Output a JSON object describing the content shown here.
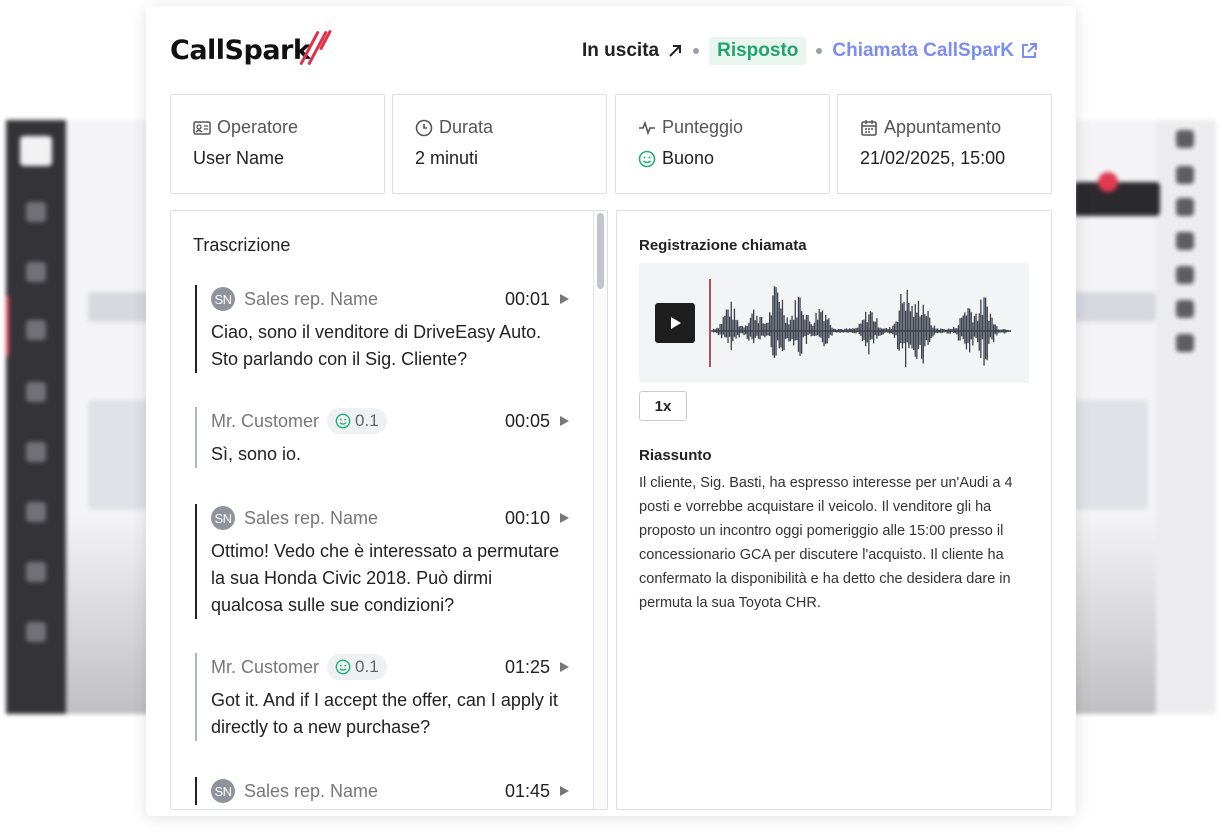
{
  "brand": {
    "name": "CallSpark",
    "accent": "#e0304a"
  },
  "header": {
    "direction": "In uscita",
    "status": "Risposto",
    "link_label": "Chiamata CallSparK"
  },
  "stats": [
    {
      "label": "Operatore",
      "value": "User Name",
      "icon": "id-card-icon"
    },
    {
      "label": "Durata",
      "value": "2 minuti",
      "icon": "clock-icon"
    },
    {
      "label": "Punteggio",
      "value": "Buono",
      "icon": "activity-icon"
    },
    {
      "label": "Appuntamento",
      "value": "21/02/2025, 15:00",
      "icon": "calendar-icon"
    }
  ],
  "transcript": {
    "title": "Trascrizione",
    "messages": [
      {
        "avatar": "SN",
        "speaker": "Sales rep. Name",
        "time": "00:01",
        "text": "Ciao, sono il venditore di DriveEasy Auto. Sto parlando con il Sig. Cliente?"
      },
      {
        "speaker": "Mr. Customer",
        "score": "0.1",
        "time": "00:05",
        "text": "Sì, sono io."
      },
      {
        "avatar": "SN",
        "speaker": "Sales rep. Name",
        "time": "00:10",
        "text": "Ottimo! Vedo che è interessato a permutare la sua Honda Civic 2018. Può dirmi qualcosa sulle sue condizioni?"
      },
      {
        "speaker": "Mr. Customer",
        "score": "0.1",
        "time": "01:25",
        "text": "Got it. And if I accept the offer, can I apply it directly to a new purchase?"
      },
      {
        "avatar": "SN",
        "speaker": "Sales rep. Name",
        "time": "01:45",
        "text": ""
      }
    ]
  },
  "recording": {
    "title": "Registrazione chiamata",
    "speed": "1x"
  },
  "summary": {
    "title": "Riassunto",
    "text": "Il cliente, Sig. Basti, ha espresso interesse per un'Audi a 4 posti e vorrebbe acquistare il veicolo. Il venditore gli ha proposto un incontro oggi pomeriggio alle 15:00 presso il concessionario GCA per discutere l'acquisto. Il cliente ha confermato la disponibilità e ha detto che desidera dare in permuta la sua Toyota CHR."
  }
}
